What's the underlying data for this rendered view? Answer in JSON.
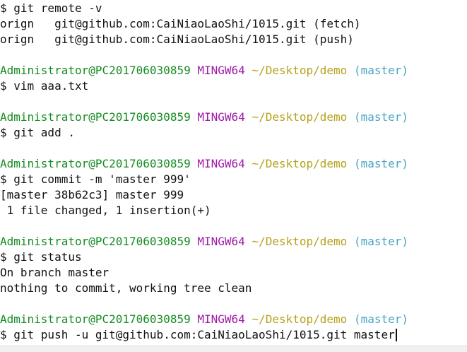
{
  "colors": {
    "background": "#ffffff",
    "text": "#111111",
    "user_host": "#168c22",
    "mingw": "#a01aa8",
    "path": "#b5a21b",
    "branch": "#4aa6c2"
  },
  "prompt": {
    "user_host": "Administrator@PC201706030859",
    "system": "MINGW64",
    "path": "~/Desktop/demo",
    "branch": "(master)",
    "symbol": "$"
  },
  "lines": [
    {
      "kind": "cmd",
      "text": "$ git remote -v"
    },
    {
      "kind": "out",
      "text": "orign   git@github.com:CaiNiaoLaoShi/1015.git (fetch)"
    },
    {
      "kind": "out",
      "text": "orign   git@github.com:CaiNiaoLaoShi/1015.git (push)"
    },
    {
      "kind": "blank"
    },
    {
      "kind": "prompt"
    },
    {
      "kind": "cmd",
      "text": "$ vim aaa.txt"
    },
    {
      "kind": "blank"
    },
    {
      "kind": "prompt"
    },
    {
      "kind": "cmd",
      "text": "$ git add ."
    },
    {
      "kind": "blank"
    },
    {
      "kind": "prompt"
    },
    {
      "kind": "cmd",
      "text": "$ git commit -m 'master 999'"
    },
    {
      "kind": "out",
      "text": "[master 38b62c3] master 999"
    },
    {
      "kind": "out",
      "text": " 1 file changed, 1 insertion(+)"
    },
    {
      "kind": "blank"
    },
    {
      "kind": "prompt"
    },
    {
      "kind": "cmd",
      "text": "$ git status"
    },
    {
      "kind": "out",
      "text": "On branch master"
    },
    {
      "kind": "out",
      "text": "nothing to commit, working tree clean"
    },
    {
      "kind": "blank"
    },
    {
      "kind": "prompt"
    },
    {
      "kind": "cmd",
      "text": "$ git push -u git@github.com:CaiNiaoLaoShi/1015.git master",
      "cursor": true
    }
  ]
}
